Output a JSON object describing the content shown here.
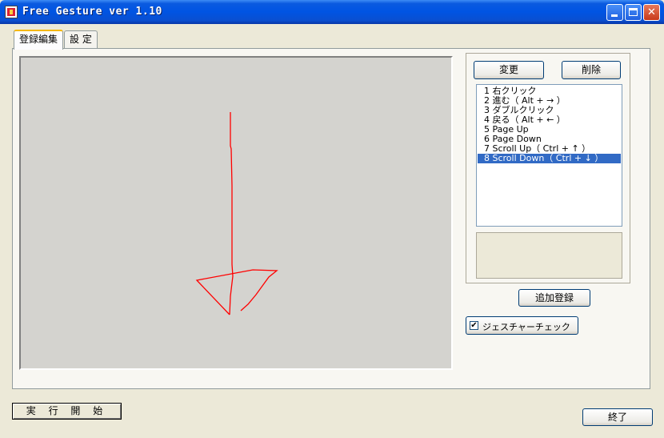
{
  "window": {
    "title": "Free Gesture  ver 1.10",
    "controls": {
      "minimize_icon": "minimize-icon",
      "maximize_icon": "maximize-icon",
      "close_icon": "close-icon"
    }
  },
  "tabs": [
    {
      "label": "登録編集",
      "active": true
    },
    {
      "label": "設 定",
      "active": false
    }
  ],
  "buttons": {
    "change": "変更",
    "delete": "削除",
    "add_register": "追加登録",
    "start": "実 行 開 始",
    "exit": "終了"
  },
  "gesture_list": {
    "items": [
      {
        "label": "1 右クリック"
      },
      {
        "label": "2 進む（ Alt + → ）"
      },
      {
        "label": "3 ダブルクリック"
      },
      {
        "label": "4 戻る（ Alt + ← ）"
      },
      {
        "label": "5 Page Up"
      },
      {
        "label": "6 Page Down"
      },
      {
        "label": "7 Scroll Up（ Ctrl + ↑ ）"
      },
      {
        "label": "8 Scroll Down（ Ctrl + ↓ ）"
      }
    ],
    "selected_index": 7
  },
  "gesture_check": {
    "label": "ジェスチャーチェック",
    "checked": true,
    "mark": "✔"
  },
  "colors": {
    "stroke": "#ff0000",
    "selection": "#316ac5",
    "titlebar": "#0054e3"
  }
}
